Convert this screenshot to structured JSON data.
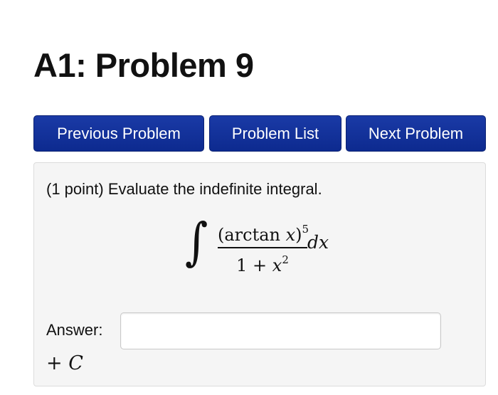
{
  "page": {
    "title": "A1: Problem 9"
  },
  "nav": {
    "previous_label": "Previous Problem",
    "list_label": "Problem List",
    "next_label": "Next Problem"
  },
  "problem": {
    "prompt": "(1 point) Evaluate the indefinite integral.",
    "math": {
      "integral_sign": "∫",
      "numerator_base": "(arctan ",
      "numerator_var": "x",
      "numerator_close": ")",
      "numerator_exponent": "5",
      "denominator_base": "1 + ",
      "denominator_var": "x",
      "denominator_exponent": "2",
      "differential": "dx"
    },
    "answer_label": "Answer:",
    "answer_value": "",
    "answer_placeholder": "",
    "constant_plus": "+ ",
    "constant_symbol": "C"
  },
  "colors": {
    "button_bg": "#0d2a8f",
    "button_text": "#ffffff",
    "panel_bg": "#f5f5f5"
  }
}
